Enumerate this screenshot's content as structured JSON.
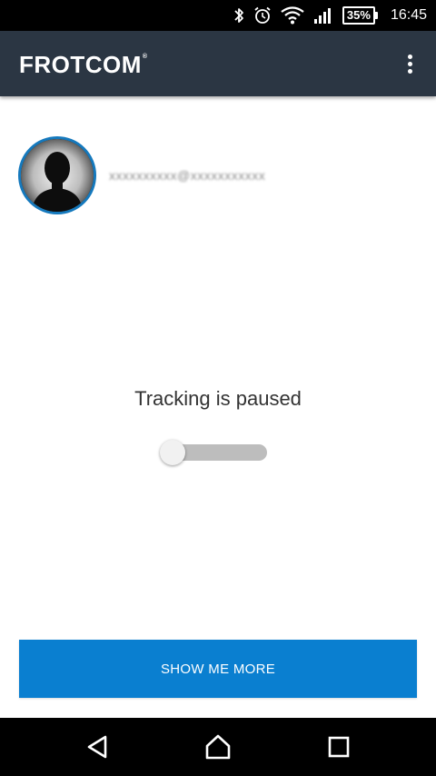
{
  "status_bar": {
    "battery_percent": "35%",
    "time": "16:45",
    "icons": [
      "bluetooth-icon",
      "alarm-icon",
      "wifi-icon",
      "signal-icon",
      "battery-icon"
    ]
  },
  "app_bar": {
    "logo_text": "FROTCOM",
    "logo_mark": "®",
    "menu_icon": "overflow-menu-icon"
  },
  "profile": {
    "email": "xxxxxxxxxx@xxxxxxxxxxx",
    "avatar_icon": "person-silhouette-icon"
  },
  "tracking": {
    "status_text": "Tracking is paused",
    "enabled": false
  },
  "actions": {
    "show_more_label": "SHOW ME MORE"
  },
  "nav_bar": {
    "icons": [
      "back-icon",
      "home-icon",
      "recents-icon"
    ]
  },
  "colors": {
    "app_bar": "#2b3643",
    "accent_button": "#0a7fd0",
    "avatar_ring": "#1579bd",
    "toggle_track": "#bdbdbd"
  }
}
